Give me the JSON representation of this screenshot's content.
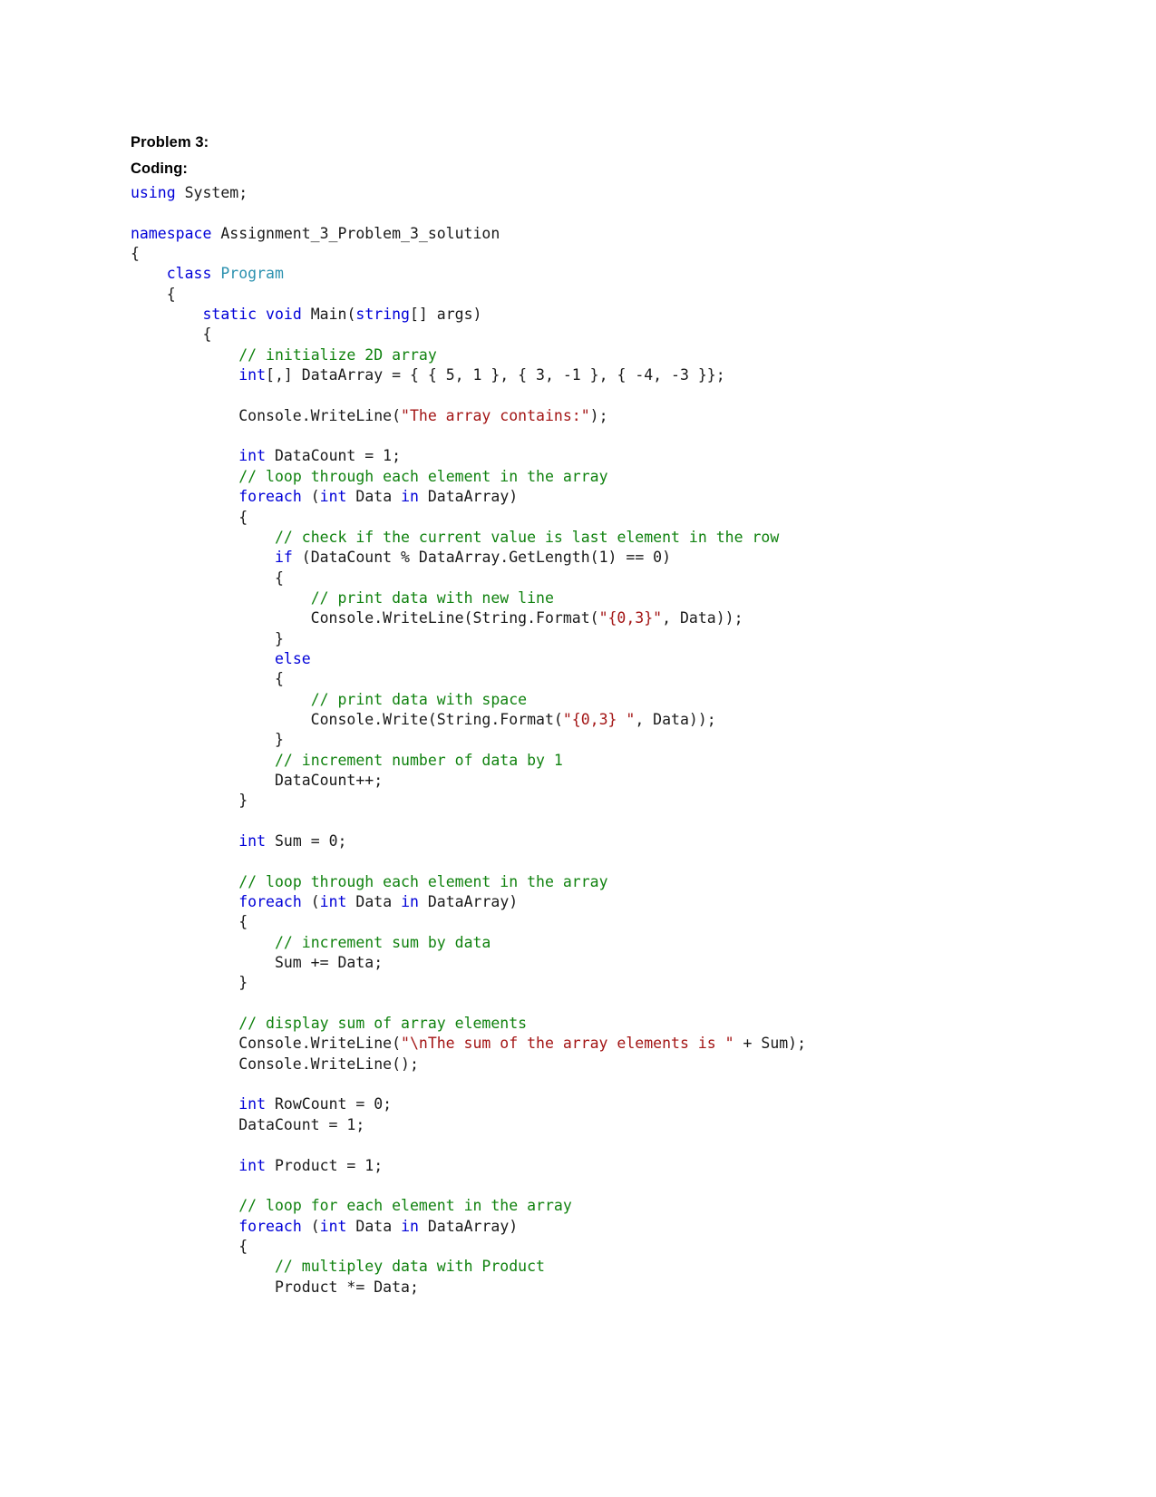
{
  "document": {
    "headings": [
      {
        "text": "Problem 3:"
      },
      {
        "text": "Coding:"
      }
    ],
    "language": "csharp",
    "colors": {
      "keyword": "#0000d8",
      "type": "#2b91af",
      "comment": "#10820f",
      "string": "#a31515",
      "plain": "#1a1a1a",
      "heading": "#000000",
      "background": "#ffffff"
    },
    "code_lines": [
      {
        "id": 1,
        "text": "using System;",
        "tokens": [
          {
            "t": "using",
            "c": "kw"
          },
          {
            "t": " System;",
            "c": "pl"
          }
        ]
      },
      {
        "id": 2,
        "text": "",
        "tokens": []
      },
      {
        "id": 3,
        "text": "namespace Assignment_3_Problem_3_solution",
        "tokens": [
          {
            "t": "namespace",
            "c": "kw"
          },
          {
            "t": " Assignment_3_Problem_3_solution",
            "c": "pl"
          }
        ]
      },
      {
        "id": 4,
        "text": "{",
        "tokens": [
          {
            "t": "{",
            "c": "pl"
          }
        ]
      },
      {
        "id": 5,
        "text": "    class Program",
        "tokens": [
          {
            "t": "    ",
            "c": "pl"
          },
          {
            "t": "class",
            "c": "kw"
          },
          {
            "t": " ",
            "c": "pl"
          },
          {
            "t": "Program",
            "c": "type"
          }
        ]
      },
      {
        "id": 6,
        "text": "    {",
        "tokens": [
          {
            "t": "    {",
            "c": "pl"
          }
        ]
      },
      {
        "id": 7,
        "text": "        static void Main(string[] args)",
        "tokens": [
          {
            "t": "        ",
            "c": "pl"
          },
          {
            "t": "static",
            "c": "kw"
          },
          {
            "t": " ",
            "c": "pl"
          },
          {
            "t": "void",
            "c": "kw"
          },
          {
            "t": " Main(",
            "c": "pl"
          },
          {
            "t": "string",
            "c": "kw"
          },
          {
            "t": "[] args)",
            "c": "pl"
          }
        ]
      },
      {
        "id": 8,
        "text": "        {",
        "tokens": [
          {
            "t": "        {",
            "c": "pl"
          }
        ]
      },
      {
        "id": 9,
        "text": "            // initialize 2D array",
        "tokens": [
          {
            "t": "            ",
            "c": "pl"
          },
          {
            "t": "// initialize 2D array",
            "c": "cm"
          }
        ]
      },
      {
        "id": 10,
        "text": "            int[,] DataArray = { { 5, 1 }, { 3, -1 }, { -4, -3 }};",
        "tokens": [
          {
            "t": "            ",
            "c": "pl"
          },
          {
            "t": "int",
            "c": "kw"
          },
          {
            "t": "[,] DataArray = { { 5, 1 }, { 3, -1 }, { -4, -3 }};",
            "c": "pl"
          }
        ]
      },
      {
        "id": 11,
        "text": "",
        "tokens": []
      },
      {
        "id": 12,
        "text": "            Console.WriteLine(\"The array contains:\");",
        "tokens": [
          {
            "t": "            Console.WriteLine(",
            "c": "pl"
          },
          {
            "t": "\"The array contains:\"",
            "c": "str"
          },
          {
            "t": ");",
            "c": "pl"
          }
        ]
      },
      {
        "id": 13,
        "text": "",
        "tokens": []
      },
      {
        "id": 14,
        "text": "            int DataCount = 1;",
        "tokens": [
          {
            "t": "            ",
            "c": "pl"
          },
          {
            "t": "int",
            "c": "kw"
          },
          {
            "t": " DataCount = 1;",
            "c": "pl"
          }
        ]
      },
      {
        "id": 15,
        "text": "            // loop through each element in the array",
        "tokens": [
          {
            "t": "            ",
            "c": "pl"
          },
          {
            "t": "// loop through each element in the array",
            "c": "cm"
          }
        ]
      },
      {
        "id": 16,
        "text": "            foreach (int Data in DataArray)",
        "tokens": [
          {
            "t": "            ",
            "c": "pl"
          },
          {
            "t": "foreach",
            "c": "kw"
          },
          {
            "t": " (",
            "c": "pl"
          },
          {
            "t": "int",
            "c": "kw"
          },
          {
            "t": " Data ",
            "c": "pl"
          },
          {
            "t": "in",
            "c": "kw"
          },
          {
            "t": " DataArray)",
            "c": "pl"
          }
        ]
      },
      {
        "id": 17,
        "text": "            {",
        "tokens": [
          {
            "t": "            {",
            "c": "pl"
          }
        ]
      },
      {
        "id": 18,
        "text": "                // check if the current value is last element in the row",
        "tokens": [
          {
            "t": "                ",
            "c": "pl"
          },
          {
            "t": "// check if the current value is last element in the row",
            "c": "cm"
          }
        ]
      },
      {
        "id": 19,
        "text": "                if (DataCount % DataArray.GetLength(1) == 0)",
        "tokens": [
          {
            "t": "                ",
            "c": "pl"
          },
          {
            "t": "if",
            "c": "kw"
          },
          {
            "t": " (DataCount % DataArray.GetLength(1) == 0)",
            "c": "pl"
          }
        ]
      },
      {
        "id": 20,
        "text": "                {",
        "tokens": [
          {
            "t": "                {",
            "c": "pl"
          }
        ]
      },
      {
        "id": 21,
        "text": "                    // print data with new line",
        "tokens": [
          {
            "t": "                    ",
            "c": "pl"
          },
          {
            "t": "// print data with new line",
            "c": "cm"
          }
        ]
      },
      {
        "id": 22,
        "text": "                    Console.WriteLine(String.Format(\"{0,3}\", Data));",
        "tokens": [
          {
            "t": "                    Console.WriteLine(String.Format(",
            "c": "pl"
          },
          {
            "t": "\"{0,3}\"",
            "c": "str"
          },
          {
            "t": ", Data));",
            "c": "pl"
          }
        ]
      },
      {
        "id": 23,
        "text": "                }",
        "tokens": [
          {
            "t": "                }",
            "c": "pl"
          }
        ]
      },
      {
        "id": 24,
        "text": "                else",
        "tokens": [
          {
            "t": "                ",
            "c": "pl"
          },
          {
            "t": "else",
            "c": "kw"
          }
        ]
      },
      {
        "id": 25,
        "text": "                {",
        "tokens": [
          {
            "t": "                {",
            "c": "pl"
          }
        ]
      },
      {
        "id": 26,
        "text": "                    // print data with space",
        "tokens": [
          {
            "t": "                    ",
            "c": "pl"
          },
          {
            "t": "// print data with space",
            "c": "cm"
          }
        ]
      },
      {
        "id": 27,
        "text": "                    Console.Write(String.Format(\"{0,3} \", Data));",
        "tokens": [
          {
            "t": "                    Console.Write(String.Format(",
            "c": "pl"
          },
          {
            "t": "\"{0,3} \"",
            "c": "str"
          },
          {
            "t": ", Data));",
            "c": "pl"
          }
        ]
      },
      {
        "id": 28,
        "text": "                }",
        "tokens": [
          {
            "t": "                }",
            "c": "pl"
          }
        ]
      },
      {
        "id": 29,
        "text": "                // increment number of data by 1",
        "tokens": [
          {
            "t": "                ",
            "c": "pl"
          },
          {
            "t": "// increment number of data by 1",
            "c": "cm"
          }
        ]
      },
      {
        "id": 30,
        "text": "                DataCount++;",
        "tokens": [
          {
            "t": "                DataCount++;",
            "c": "pl"
          }
        ]
      },
      {
        "id": 31,
        "text": "            }",
        "tokens": [
          {
            "t": "            }",
            "c": "pl"
          }
        ]
      },
      {
        "id": 32,
        "text": "",
        "tokens": []
      },
      {
        "id": 33,
        "text": "            int Sum = 0;",
        "tokens": [
          {
            "t": "            ",
            "c": "pl"
          },
          {
            "t": "int",
            "c": "kw"
          },
          {
            "t": " Sum = 0;",
            "c": "pl"
          }
        ]
      },
      {
        "id": 34,
        "text": "",
        "tokens": []
      },
      {
        "id": 35,
        "text": "            // loop through each element in the array",
        "tokens": [
          {
            "t": "            ",
            "c": "pl"
          },
          {
            "t": "// loop through each element in the array",
            "c": "cm"
          }
        ]
      },
      {
        "id": 36,
        "text": "            foreach (int Data in DataArray)",
        "tokens": [
          {
            "t": "            ",
            "c": "pl"
          },
          {
            "t": "foreach",
            "c": "kw"
          },
          {
            "t": " (",
            "c": "pl"
          },
          {
            "t": "int",
            "c": "kw"
          },
          {
            "t": " Data ",
            "c": "pl"
          },
          {
            "t": "in",
            "c": "kw"
          },
          {
            "t": " DataArray)",
            "c": "pl"
          }
        ]
      },
      {
        "id": 37,
        "text": "            {",
        "tokens": [
          {
            "t": "            {",
            "c": "pl"
          }
        ]
      },
      {
        "id": 38,
        "text": "                // increment sum by data",
        "tokens": [
          {
            "t": "                ",
            "c": "pl"
          },
          {
            "t": "// increment sum by data",
            "c": "cm"
          }
        ]
      },
      {
        "id": 39,
        "text": "                Sum += Data;",
        "tokens": [
          {
            "t": "                Sum += Data;",
            "c": "pl"
          }
        ]
      },
      {
        "id": 40,
        "text": "            }",
        "tokens": [
          {
            "t": "            }",
            "c": "pl"
          }
        ]
      },
      {
        "id": 41,
        "text": "",
        "tokens": []
      },
      {
        "id": 42,
        "text": "            // display sum of array elements",
        "tokens": [
          {
            "t": "            ",
            "c": "pl"
          },
          {
            "t": "// display sum of array elements",
            "c": "cm"
          }
        ]
      },
      {
        "id": 43,
        "text": "            Console.WriteLine(\"\\nThe sum of the array elements is \" + Sum);",
        "tokens": [
          {
            "t": "            Console.WriteLine(",
            "c": "pl"
          },
          {
            "t": "\"\\nThe sum of the array elements is \"",
            "c": "str"
          },
          {
            "t": " + Sum);",
            "c": "pl"
          }
        ]
      },
      {
        "id": 44,
        "text": "            Console.WriteLine();",
        "tokens": [
          {
            "t": "            Console.WriteLine();",
            "c": "pl"
          }
        ]
      },
      {
        "id": 45,
        "text": "",
        "tokens": []
      },
      {
        "id": 46,
        "text": "            int RowCount = 0;",
        "tokens": [
          {
            "t": "            ",
            "c": "pl"
          },
          {
            "t": "int",
            "c": "kw"
          },
          {
            "t": " RowCount = 0;",
            "c": "pl"
          }
        ]
      },
      {
        "id": 47,
        "text": "            DataCount = 1;",
        "tokens": [
          {
            "t": "            DataCount = 1;",
            "c": "pl"
          }
        ]
      },
      {
        "id": 48,
        "text": "",
        "tokens": []
      },
      {
        "id": 49,
        "text": "            int Product = 1;",
        "tokens": [
          {
            "t": "            ",
            "c": "pl"
          },
          {
            "t": "int",
            "c": "kw"
          },
          {
            "t": " Product = 1;",
            "c": "pl"
          }
        ]
      },
      {
        "id": 50,
        "text": "",
        "tokens": []
      },
      {
        "id": 51,
        "text": "            // loop for each element in the array",
        "tokens": [
          {
            "t": "            ",
            "c": "pl"
          },
          {
            "t": "// loop for each element in the array",
            "c": "cm"
          }
        ]
      },
      {
        "id": 52,
        "text": "            foreach (int Data in DataArray)",
        "tokens": [
          {
            "t": "            ",
            "c": "pl"
          },
          {
            "t": "foreach",
            "c": "kw"
          },
          {
            "t": " (",
            "c": "pl"
          },
          {
            "t": "int",
            "c": "kw"
          },
          {
            "t": " Data ",
            "c": "pl"
          },
          {
            "t": "in",
            "c": "kw"
          },
          {
            "t": " DataArray)",
            "c": "pl"
          }
        ]
      },
      {
        "id": 53,
        "text": "            {",
        "tokens": [
          {
            "t": "            {",
            "c": "pl"
          }
        ]
      },
      {
        "id": 54,
        "text": "                // multipley data with Product",
        "tokens": [
          {
            "t": "                ",
            "c": "pl"
          },
          {
            "t": "// multipley data with Product",
            "c": "cm"
          }
        ]
      },
      {
        "id": 55,
        "text": "                Product *= Data;",
        "tokens": [
          {
            "t": "                Product *= Data;",
            "c": "pl"
          }
        ]
      }
    ]
  }
}
